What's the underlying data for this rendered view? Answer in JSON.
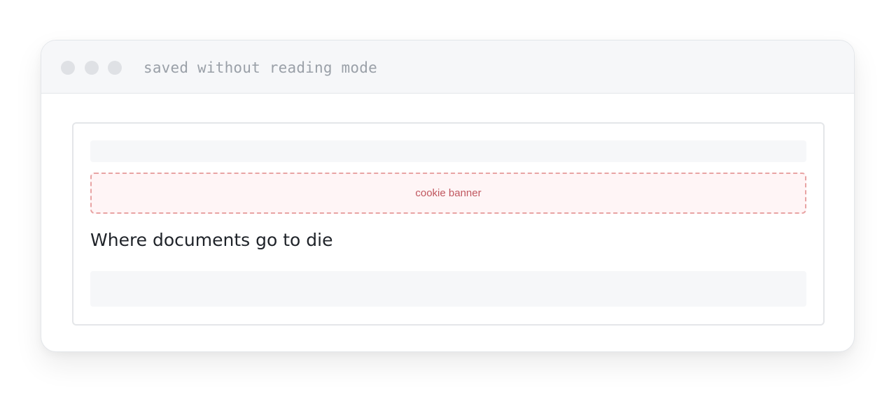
{
  "window": {
    "title": "saved without reading mode"
  },
  "page": {
    "cookie_banner_label": "cookie banner",
    "headline": "Where documents go to die"
  }
}
